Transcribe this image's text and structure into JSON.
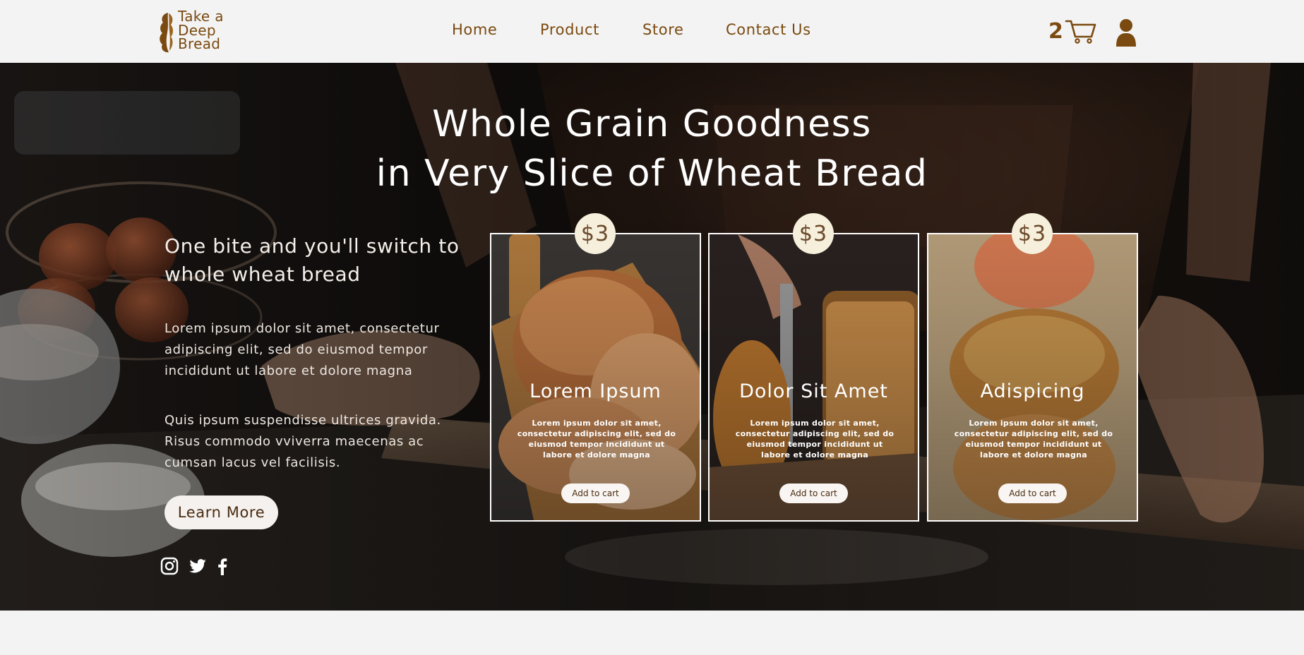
{
  "header": {
    "logo_lines": [
      "Take a",
      "Deep",
      "Bread"
    ],
    "nav": [
      "Home",
      "Product",
      "Store",
      "Contact Us"
    ],
    "cart_count": "2"
  },
  "hero": {
    "title_lines": [
      "Whole Grain Goodness",
      "in Very Slice of Wheat Bread"
    ],
    "lead": "One bite and you'll switch to whole wheat bread",
    "paragraph1": "Lorem ipsum dolor sit amet, consectetur adipiscing elit, sed do eiusmod tempor incididunt ut labore et dolore magna",
    "paragraph2": "Quis ipsum suspendisse ultrices gravida. Risus commodo vviverra maecenas ac cumsan lacus vel facilisis.",
    "button_label": "Learn More",
    "social": [
      "instagram-icon",
      "twitter-icon",
      "facebook-icon"
    ]
  },
  "cards": [
    {
      "price": "$3",
      "title": "Lorem Ipsum",
      "description": "Lorem ipsum dolor sit amet, consectetur adipiscing elit, sed do eiusmod tempor incididunt ut labore et dolore magna",
      "button_label": "Add to cart"
    },
    {
      "price": "$3",
      "title": "Dolor Sit Amet",
      "description": "Lorem ipsum dolor sit amet, consectetur adipiscing elit, sed do eiusmod tempor incididunt ut labore et dolore magna",
      "button_label": "Add to cart"
    },
    {
      "price": "$3",
      "title": "Adispicing",
      "description": "Lorem ipsum dolor sit amet, consectetur adipiscing elit, sed do eiusmod tempor incididunt ut labore et dolore magna",
      "button_label": "Add to cart"
    }
  ],
  "colors": {
    "brand": "#7a4a10",
    "page_background": "#f3f3f3",
    "price_badge": "#f5efdc"
  }
}
